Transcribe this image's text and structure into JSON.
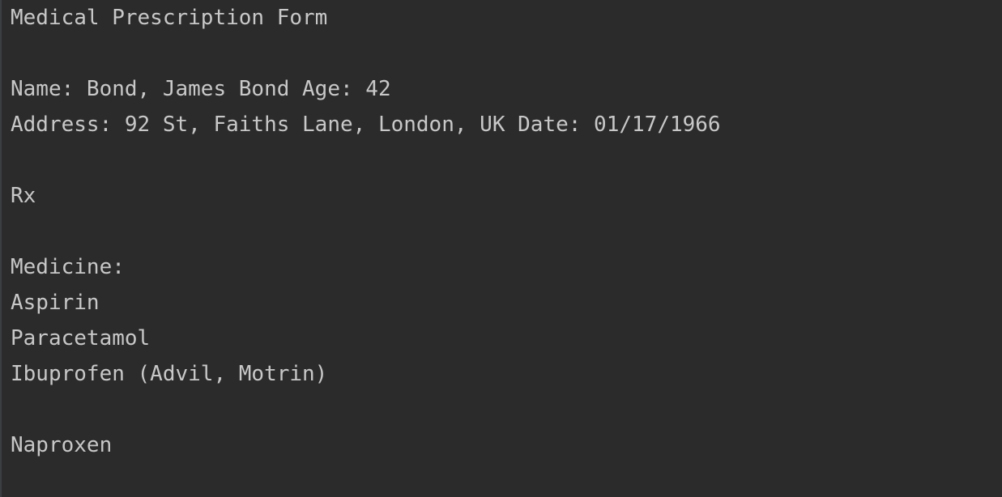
{
  "console": {
    "title": "Medical Prescription Form",
    "patient_line": "Name: Bond, James Bond Age: 42",
    "address_line": "Address: 92 St, Faiths Lane, London, UK Date: 01/17/1966",
    "rx_label": "Rx",
    "medicine_label": "Medicine:",
    "medicines": [
      "Aspirin",
      "Paracetamol",
      "Ibuprofen (Advil, Motrin)"
    ],
    "extra_medicine": "Naproxen"
  }
}
